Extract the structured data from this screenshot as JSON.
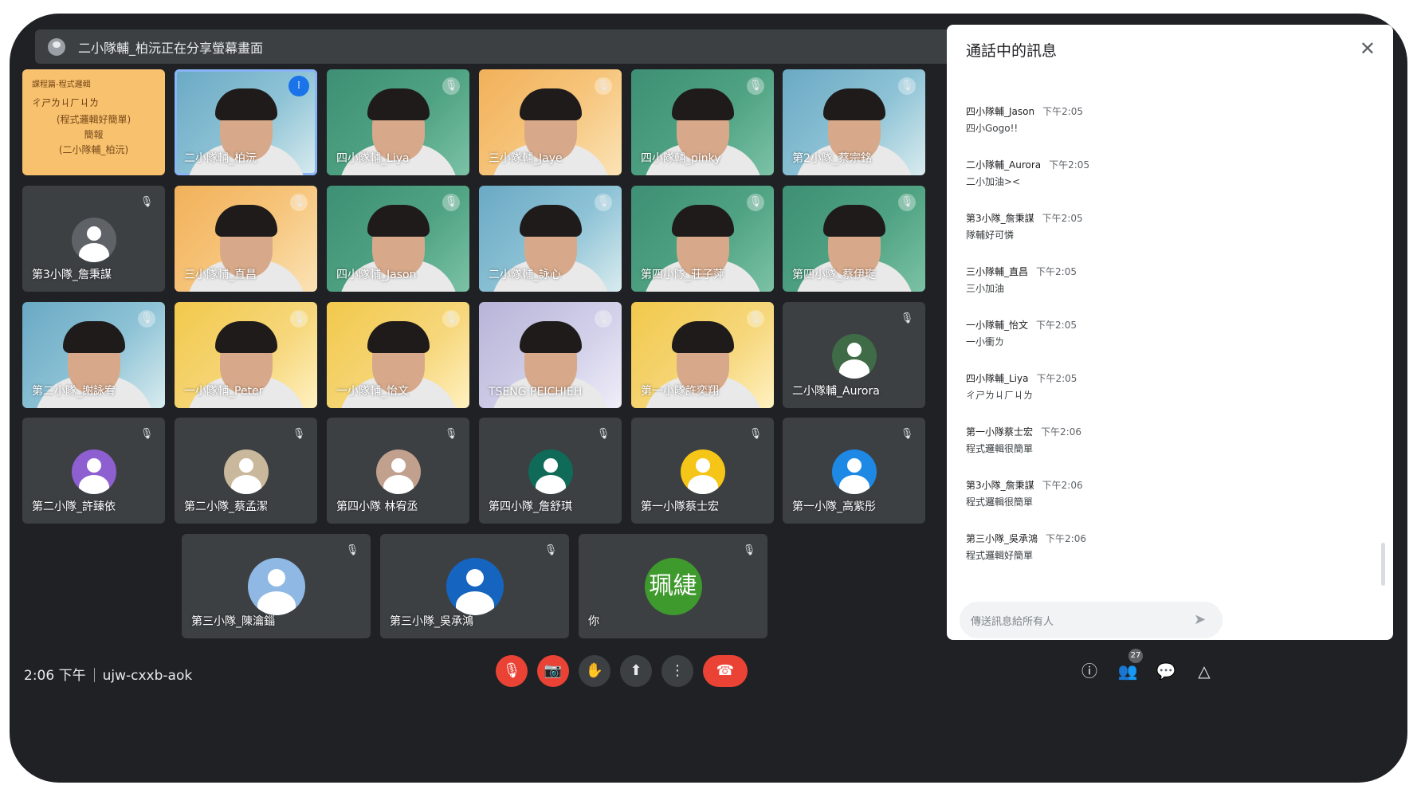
{
  "share_banner": {
    "text": "二小隊輔_柏沅正在分享螢幕畫面"
  },
  "slide_tile": {
    "line1": "課程篇-程式邏輯",
    "line2": "ㄔㄕㄌㄐㄏㄐㄌ",
    "line3": "(程式邏輯好簡單)",
    "line4": "簡報",
    "line5": "(二小隊輔_柏沅)"
  },
  "tiles": [
    {
      "name": "二小隊輔_柏沅",
      "style": "video-blue",
      "mic": "speaking"
    },
    {
      "name": "四小隊輔_Liya",
      "style": "video-green",
      "mic": "muted"
    },
    {
      "name": "三小隊輔_Jaye",
      "style": "video-orange",
      "mic": "muted"
    },
    {
      "name": "四小隊輔_pinky",
      "style": "video-green",
      "mic": "muted"
    },
    {
      "name": "第2小隊_蔡宗銘",
      "style": "video-blue",
      "mic": "muted"
    },
    {
      "name": "第3小隊_詹秉謀",
      "style": "avatar",
      "mic": "muted",
      "avatar_color": "#5f6368"
    },
    {
      "name": "三小隊輔_直昌",
      "style": "video-orange",
      "mic": "muted"
    },
    {
      "name": "四小隊輔_Jason",
      "style": "video-green",
      "mic": "muted"
    },
    {
      "name": "二小隊輔_詠心",
      "style": "video-blue",
      "mic": "muted"
    },
    {
      "name": "第四小隊_莊子萍",
      "style": "video-green",
      "mic": "muted"
    },
    {
      "name": "第四小隊_蔡伊琁",
      "style": "video-green",
      "mic": "muted"
    },
    {
      "name": "第二小隊_謝詠宥",
      "style": "video-blue",
      "mic": "muted"
    },
    {
      "name": "一小隊輔_Peter",
      "style": "video-yellow",
      "mic": "muted"
    },
    {
      "name": "一小隊輔_怡文",
      "style": "video-yellow",
      "mic": "muted"
    },
    {
      "name": "TSENG PEICHIEH",
      "style": "video-lav",
      "mic": "muted"
    },
    {
      "name": "第一小隊許奕翔",
      "style": "video-yellow",
      "mic": "muted"
    },
    {
      "name": "二小隊輔_Aurora",
      "style": "avatar",
      "mic": "muted",
      "avatar_color": "#3f6b46"
    },
    {
      "name": "第二小隊_許臻依",
      "style": "avatar",
      "mic": "muted",
      "avatar_color": "#8e5fd0"
    },
    {
      "name": "第二小隊_蔡孟潔",
      "style": "avatar",
      "mic": "muted",
      "avatar_color": "#c9b89c"
    },
    {
      "name": "第四小隊 林宥丞",
      "style": "avatar",
      "mic": "muted",
      "avatar_color": "#c1a08e"
    },
    {
      "name": "第四小隊_詹舒琪",
      "style": "avatar",
      "mic": "muted",
      "avatar_color": "#0f6b58"
    },
    {
      "name": "第一小隊蔡士宏",
      "style": "avatar",
      "mic": "muted",
      "avatar_color": "#f5c518"
    },
    {
      "name": "第一小隊_高紫彤",
      "style": "avatar",
      "mic": "muted",
      "avatar_color": "#1e88e5"
    },
    {
      "name": "第三小隊_陳瀹錙",
      "style": "avatar",
      "mic": "muted",
      "avatar_color": "#8fb9e4"
    },
    {
      "name": "第三小隊_吳承鴻",
      "style": "avatar",
      "mic": "muted",
      "avatar_color": "#1565c0"
    },
    {
      "name": "你",
      "style": "avatar",
      "mic": "muted",
      "avatar_color": "#3f9a2e",
      "avatar_text": "珮緁"
    }
  ],
  "chat": {
    "title": "通話中的訊息",
    "messages": [
      {
        "sender": "四小隊輔_Jason",
        "time": "下午2:05",
        "text": "四小Gogo!!"
      },
      {
        "sender": "二小隊輔_Aurora",
        "time": "下午2:05",
        "text": "二小加油><"
      },
      {
        "sender": "第3小隊_詹秉謀",
        "time": "下午2:05",
        "text": "隊輔好可憐"
      },
      {
        "sender": "三小隊輔_直昌",
        "time": "下午2:05",
        "text": "三小加油"
      },
      {
        "sender": "一小隊輔_怡文",
        "time": "下午2:05",
        "text": "一小衝ㄌ"
      },
      {
        "sender": "四小隊輔_Liya",
        "time": "下午2:05",
        "text": "ㄔㄕㄌㄐㄏㄐㄌ"
      },
      {
        "sender": "第一小隊蔡士宏",
        "time": "下午2:06",
        "text": "程式邏輯很簡單"
      },
      {
        "sender": "第3小隊_詹秉謀",
        "time": "下午2:06",
        "text": "程式邏輯很簡單"
      },
      {
        "sender": "第三小隊_吳承鴻",
        "time": "下午2:06",
        "text": "程式邏輯好簡單"
      }
    ],
    "input_placeholder": "傳送訊息給所有人"
  },
  "bottom": {
    "time": "2:06 下午",
    "meeting_code": "ujw-cxxb-aok",
    "participants_count": "27"
  },
  "icons": {
    "mic_off": "mic-off-icon",
    "camera_off": "camera-off-icon",
    "raise_hand": "hand-icon",
    "present": "present-icon",
    "more": "more-vert-icon",
    "hang_up": "call-end-icon",
    "info": "info-icon",
    "people": "people-icon",
    "chat": "chat-icon",
    "activities": "shapes-icon"
  },
  "colors": {
    "background": "#202124",
    "tile": "#3c4043",
    "danger": "#ea4335",
    "accent": "#8ab4f8"
  }
}
